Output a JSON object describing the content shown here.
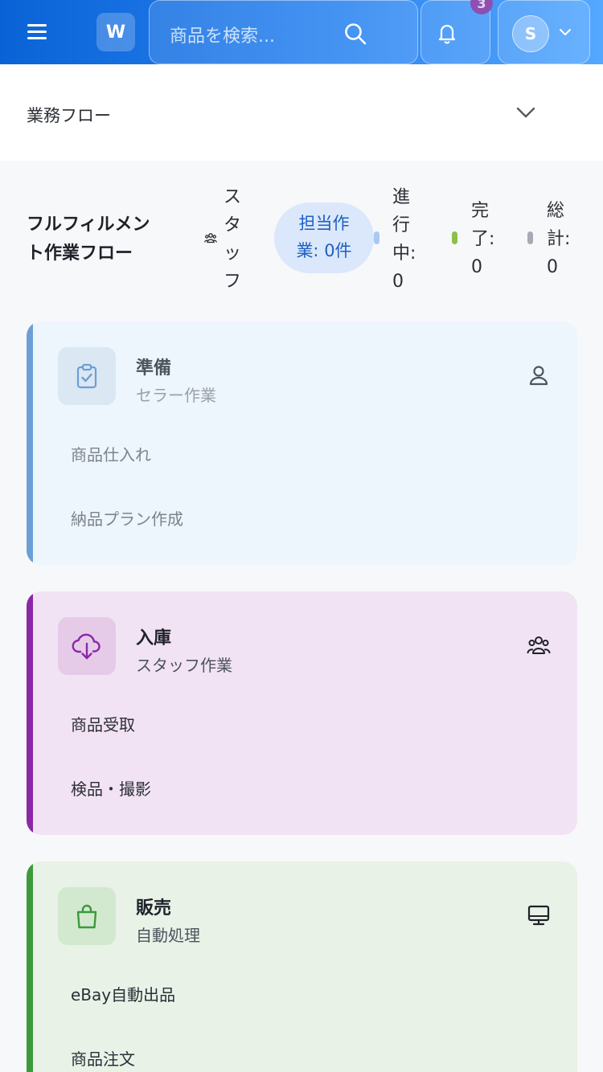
{
  "header": {
    "logo": "W",
    "search_placeholder": "商品を検索...",
    "notification_count": "3",
    "user_initial": "S"
  },
  "section": {
    "title": "業務フロー"
  },
  "flow": {
    "title_line1": "フルフィルメン",
    "title_line2": "ト作業フロー",
    "staff_chars": [
      "ス",
      "タ",
      "ッ",
      "フ"
    ],
    "assigned_line1": "担当作",
    "assigned_line2": "業: 0件",
    "in_progress": [
      "進",
      "行",
      "中:",
      "0"
    ],
    "completed": [
      "完",
      "了:",
      "0"
    ],
    "total": [
      "総",
      "計:",
      "0"
    ]
  },
  "cards": [
    {
      "title": "準備",
      "subtitle": "セラー作業",
      "items": [
        "商品仕入れ",
        "納品プラン作成"
      ],
      "icon": "clipboard-check-icon",
      "right_icon": "user-icon"
    },
    {
      "title": "入庫",
      "subtitle": "スタッフ作業",
      "items": [
        "商品受取",
        "検品・撮影"
      ],
      "icon": "cloud-download-icon",
      "right_icon": "users-icon"
    },
    {
      "title": "販売",
      "subtitle": "自動処理",
      "items": [
        "eBay自動出品",
        "商品注文"
      ],
      "icon": "shopping-bag-icon",
      "right_icon": "monitor-icon"
    }
  ],
  "colors": {
    "header_start": "#0a63d6",
    "header_end": "#55a8ff",
    "prep_bg": "#edf5fd",
    "prep_bar": "#6c9fd6",
    "inbound_bg": "#f2e3f4",
    "inbound_bar": "#8b27a8",
    "sales_bg": "#e8f2e7",
    "sales_bar": "#3c9a3a",
    "status_blue": "#a9c8f5",
    "status_green": "#8cc04a",
    "status_gray": "#a6aab3"
  }
}
